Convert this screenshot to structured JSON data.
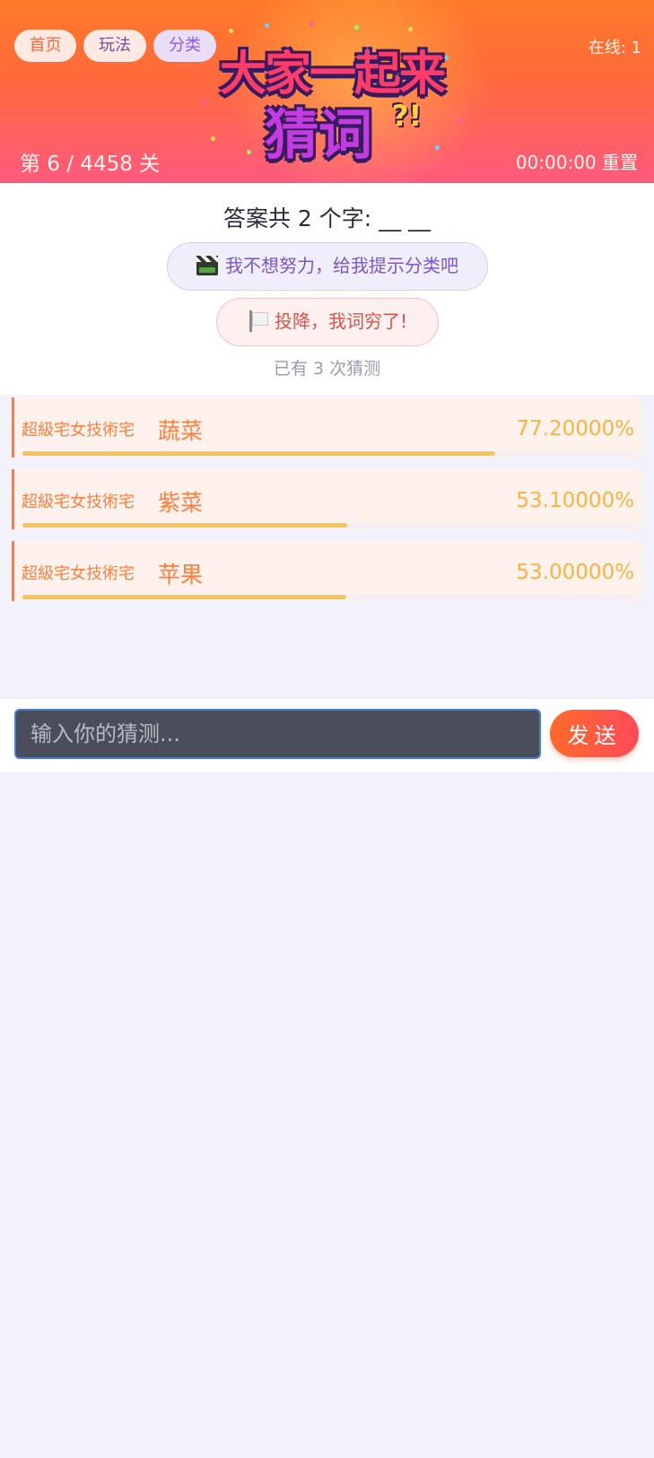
{
  "nav": {
    "home": "首页",
    "rules": "玩法",
    "category": "分类"
  },
  "logo": {
    "line1": "大家一起来",
    "line2": "猜词",
    "mark": "?!"
  },
  "status": {
    "online": "在线: 1",
    "level": "第 6 / 4458 关",
    "timer": "00:00:00 重置"
  },
  "prompt": {
    "answer_info": "答案共 2 个字: __ __",
    "hint_button": "我不想努力，给我提示分类吧",
    "hint_icon": "clapper-board-icon",
    "give_up_button": "投降，我词穷了!",
    "give_up_icon": "white-flag-icon",
    "guess_count": "已有 3 次猜测"
  },
  "guesses": [
    {
      "user": "超級宅女技術宅",
      "word": "蔬菜",
      "score": "77.20000%",
      "fill": 77.2
    },
    {
      "user": "超級宅女技術宅",
      "word": "紫菜",
      "score": "53.10000%",
      "fill": 53.1
    },
    {
      "user": "超級宅女技術宅",
      "word": "苹果",
      "score": "53.00000%",
      "fill": 53.0
    }
  ],
  "input": {
    "placeholder": "输入你的猜测...",
    "value": "",
    "send_label": "发送"
  },
  "colors": {
    "accent": "#ff6a3a",
    "score": "#f5b444",
    "hint": "#7a55c8",
    "give_up": "#d6544c"
  }
}
